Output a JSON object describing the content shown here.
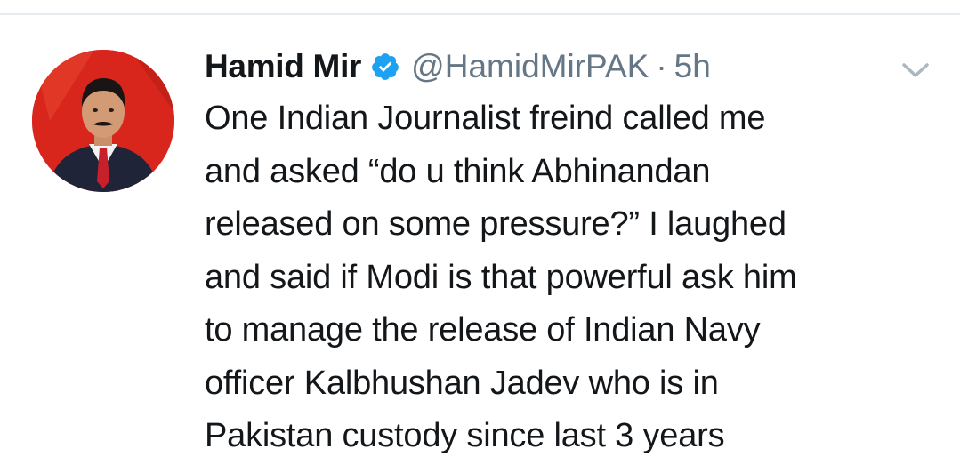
{
  "tweet": {
    "author_name": "Hamid Mir",
    "handle": "@HamidMirPAK",
    "separator": "·",
    "time": "5h",
    "verified": true,
    "text_lines": [
      "One Indian Journalist freind called me",
      "and asked “do u think Abhinandan",
      "released on some pressure?” I laughed",
      "and said if Modi is that powerful ask him",
      "to manage the release of Indian Navy",
      "officer Kalbhushan Jadev who is in",
      "Pakistan custody since last 3 years"
    ]
  },
  "icons": {
    "verified": "verified-badge-icon",
    "caret": "chevron-down-icon",
    "avatar": "avatar"
  },
  "colors": {
    "text_primary": "#14171a",
    "text_secondary": "#657786",
    "verified_blue": "#1da1f2",
    "divider": "#e6ecf0",
    "avatar_background": "#d8261c"
  }
}
